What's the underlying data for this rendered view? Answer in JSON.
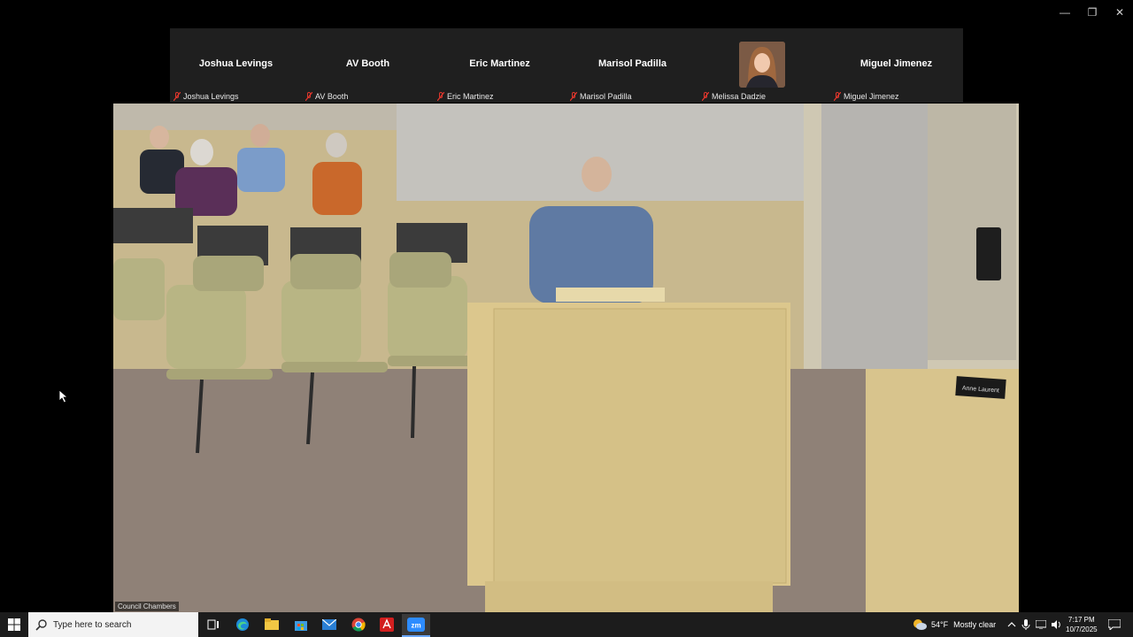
{
  "window": {
    "minimize_glyph": "—",
    "restore_glyph": "❐",
    "close_glyph": "✕"
  },
  "participants": [
    {
      "name": "Joshua Levings",
      "label": "Joshua Levings"
    },
    {
      "name": "AV Booth",
      "label": "AV Booth"
    },
    {
      "name": "Eric Martinez",
      "label": "Eric Martinez"
    },
    {
      "name": "Marisol Padilla",
      "label": "Marisol Padilla"
    },
    {
      "name": "",
      "label": "Melissa Dadzie"
    },
    {
      "name": "Miguel Jimenez",
      "label": "Miguel Jimenez"
    }
  ],
  "video": {
    "room_label": "Council Chambers",
    "nameplate": "Anne Laurent"
  },
  "taskbar": {
    "search_placeholder": "Type here to search",
    "weather_temp": "54°F",
    "weather_desc": "Mostly clear",
    "time": "7:17 PM",
    "date": "10/7/2025",
    "pinned_apps": [
      "task-view",
      "edge",
      "file-explorer",
      "store",
      "mail",
      "chrome",
      "acrobat",
      "zoom"
    ],
    "zoom_label": "zm"
  },
  "colors": {
    "muted_mic": "#e0362c",
    "taskbar_bg": "#1c1c1c",
    "zoom_blue": "#2d8cff",
    "tile_bg": "#1f1f1f"
  }
}
